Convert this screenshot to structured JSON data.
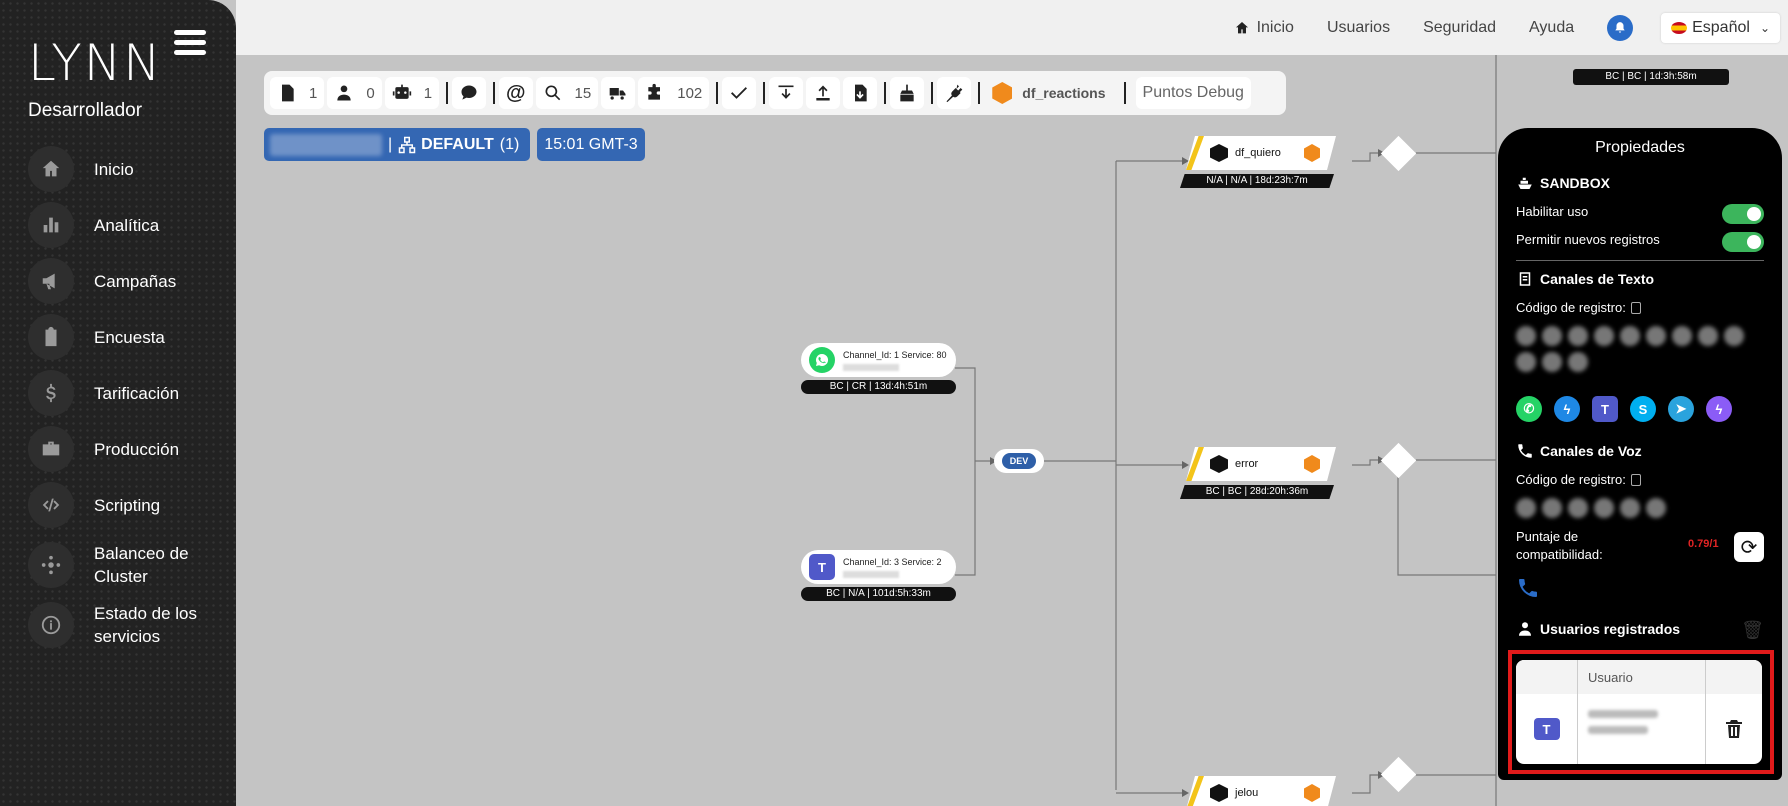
{
  "app": {
    "logo": "LYNN",
    "role": "Desarrollador"
  },
  "sidebar": {
    "items": [
      {
        "label": "Inicio",
        "icon": "home-icon"
      },
      {
        "label": "Analítica",
        "icon": "bar-chart-icon"
      },
      {
        "label": "Campañas",
        "icon": "megaphone-icon"
      },
      {
        "label": "Encuesta",
        "icon": "clipboard-icon"
      },
      {
        "label": "Tarificación",
        "icon": "dollar-icon"
      },
      {
        "label": "Producción",
        "icon": "briefcase-icon"
      },
      {
        "label": "Scripting",
        "icon": "code-icon"
      },
      {
        "label": "Balanceo de Cluster",
        "icon": "cluster-icon"
      },
      {
        "label": "Estado de los servicios",
        "icon": "info-icon"
      }
    ]
  },
  "topnav": {
    "home": "Inicio",
    "users": "Usuarios",
    "security": "Seguridad",
    "help": "Ayuda",
    "language": "Español"
  },
  "toolbar": {
    "count1": "1",
    "count2": "0",
    "count3": "1",
    "count_search": "15",
    "count_puzzle": "102",
    "module": "df_reactions",
    "debug": "Puntos Debug"
  },
  "chips": {
    "sep": "|",
    "group": "DEFAULT",
    "group_count": "(1)",
    "time": "15:01 GMT-3"
  },
  "flow": {
    "whatsapp_node": {
      "text": "Channel_Id: 1 Service: 80",
      "status": "BC | CR | 13d:4h:51m"
    },
    "teams_node": {
      "text": "Channel_Id: 3 Service: 2",
      "status": "BC | N/A | 101d:5h:33m"
    },
    "dev_label": "DEV",
    "df_quiero": {
      "name": "df_quiero",
      "status": "N/A | N/A | 18d:23h:7m"
    },
    "error": {
      "name": "error",
      "status": "BC | BC | 28d:20h:36m"
    },
    "jelou": {
      "name": "jelou"
    },
    "top_status": "BC | BC | 1d:3h:58m"
  },
  "properties": {
    "title": "Propiedades",
    "sandbox": "SANDBOX",
    "enable_use": "Habilitar uso",
    "allow_new": "Permitir nuevos registros",
    "text_channels": "Canales de Texto",
    "reg_code": "Código de registro:",
    "voice_channels": "Canales de Voz",
    "reg_code_voice": "Código de registro:",
    "score_label": "Puntaje de compatibilidad:",
    "score_value": "0.79/1",
    "registered_users": "Usuarios registrados",
    "table_header_user": "Usuario"
  },
  "colors": {
    "accent": "#3467b3",
    "toggle_on": "#3cb55c",
    "alert": "#e21b1b",
    "cube": "#f08a1c"
  }
}
